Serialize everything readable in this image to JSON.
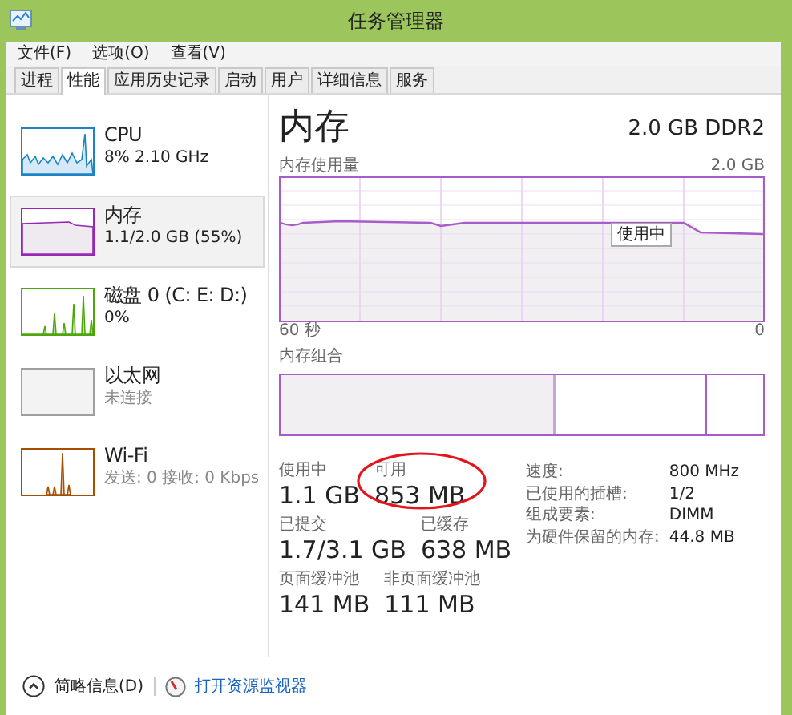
{
  "window": {
    "title": "任务管理器"
  },
  "menu": [
    "文件(F)",
    "选项(O)",
    "查看(V)"
  ],
  "tabs": [
    {
      "label": "进程",
      "selected": false
    },
    {
      "label": "性能",
      "selected": true
    },
    {
      "label": "应用历史记录",
      "selected": false
    },
    {
      "label": "启动",
      "selected": false
    },
    {
      "label": "用户",
      "selected": false
    },
    {
      "label": "详细信息",
      "selected": false
    },
    {
      "label": "服务",
      "selected": false
    }
  ],
  "resources": [
    {
      "kind": "cpu",
      "name": "CPU",
      "detail": "8% 2.10 GHz",
      "color": "#1c84c6",
      "selected": false,
      "detail_dimmed": false
    },
    {
      "kind": "memory",
      "name": "内存",
      "detail": "1.1/2.0 GB (55%)",
      "color": "#9528b4",
      "selected": true,
      "detail_dimmed": false
    },
    {
      "kind": "disk",
      "name": "磁盘 0 (C: E: D:)",
      "detail": "0%",
      "color": "#4da60c",
      "selected": false,
      "detail_dimmed": false
    },
    {
      "kind": "ethernet",
      "name": "以太网",
      "detail": "未连接",
      "color": "#a0a0a0",
      "selected": false,
      "detail_dimmed": true
    },
    {
      "kind": "wifi",
      "name": "Wi-Fi",
      "detail": "发送: 0 接收: 0 Kbps",
      "color": "#a74f01",
      "selected": false,
      "detail_dimmed": true
    }
  ],
  "detail": {
    "title": "内存",
    "spec": "2.0 GB DDR2",
    "usage_chart": {
      "label": "内存使用量",
      "max": "2.0 GB",
      "time_start": "60 秒",
      "time_end": "0",
      "tooltip": "使用中"
    },
    "composition": {
      "label": "内存组合",
      "level": 0.57
    },
    "stat_rows": [
      {
        "items": [
          {
            "label": "使用中",
            "value": "1.1 GB",
            "circled": false
          },
          {
            "label": "可用",
            "value": "853 MB",
            "circled": true
          }
        ]
      },
      {
        "items": [
          {
            "label": "已提交",
            "value": "1.7/3.1 GB",
            "circled": false
          },
          {
            "label": "已缓存",
            "value": "638 MB",
            "circled": false
          }
        ]
      },
      {
        "items": [
          {
            "label": "页面缓冲池",
            "value": "141 MB",
            "circled": false
          },
          {
            "label": "非页面缓冲池",
            "value": "111 MB",
            "circled": false
          }
        ]
      }
    ],
    "properties": [
      {
        "label": "速度:",
        "value": "800 MHz"
      },
      {
        "label": "已使用的插槽:",
        "value": "1/2"
      },
      {
        "label": "组成要素:",
        "value": "DIMM"
      },
      {
        "label": "为硬件保留的内存:",
        "value": "44.8 MB"
      }
    ]
  },
  "footer": {
    "summary": "简略信息(D)",
    "link": "打开资源监视器"
  }
}
